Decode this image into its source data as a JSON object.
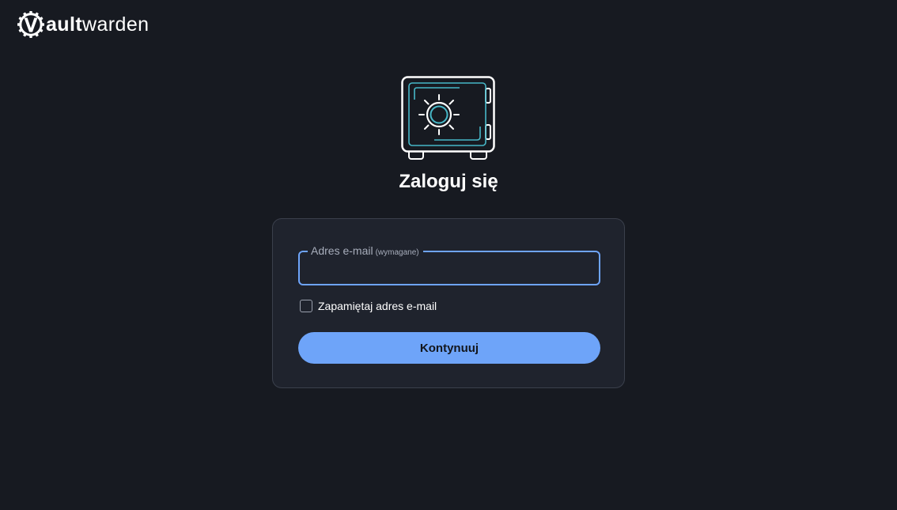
{
  "brand": {
    "logo_bold": "ault",
    "logo_light": "warden",
    "logo_icon": "vaultwarden-gear-logo"
  },
  "hero": {
    "icon": "safe-icon",
    "heading": "Zaloguj się"
  },
  "form": {
    "email_label": "Adres e-mail",
    "email_required": "(wymagane)",
    "email_value": "",
    "remember_label": "Zapamiętaj adres e-mail",
    "remember_checked": false,
    "submit_label": "Kontynuuj"
  },
  "colors": {
    "background": "#171a21",
    "card": "#1f232d",
    "accent": "#6ea4f9",
    "safe_inner": "#47b8c8"
  }
}
